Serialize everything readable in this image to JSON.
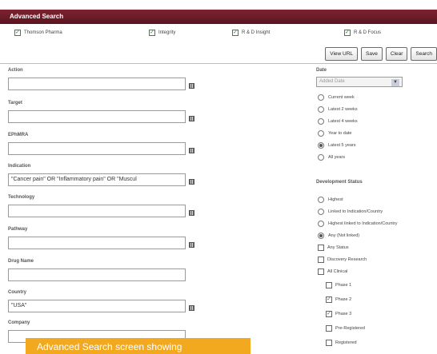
{
  "window": {
    "title": "Advanced Search"
  },
  "databases": [
    {
      "label": "Thomson Pharma",
      "checked": true
    },
    {
      "label": "Integrity",
      "checked": true
    },
    {
      "label": "R & D Insight",
      "checked": true
    },
    {
      "label": "R & D Focus",
      "checked": true
    }
  ],
  "toolbar": {
    "view_url": "View URL",
    "save": "Save",
    "clear": "Clear",
    "search": "Search"
  },
  "fields": [
    {
      "label": "Action",
      "value": ""
    },
    {
      "label": "Target",
      "value": ""
    },
    {
      "label": "EPhMRA",
      "value": ""
    },
    {
      "label": "Indication",
      "value": "\"Cancer pain\" OR \"Inflammatory pain\" OR \"Muscul"
    },
    {
      "label": "Technology",
      "value": ""
    },
    {
      "label": "Pathway",
      "value": ""
    },
    {
      "label": "Drug Name",
      "value": ""
    },
    {
      "label": "Country",
      "value": "\"USA\""
    },
    {
      "label": "Company",
      "value": ""
    }
  ],
  "date": {
    "label": "Date",
    "select_value": "Added Date",
    "options": [
      {
        "label": "Current week",
        "selected": false
      },
      {
        "label": "Latest 2 weeks",
        "selected": false
      },
      {
        "label": "Latest 4 weeks",
        "selected": false
      },
      {
        "label": "Year to date",
        "selected": false
      },
      {
        "label": "Latest 5 years",
        "selected": true
      },
      {
        "label": "All years",
        "selected": false
      }
    ]
  },
  "status": {
    "label": "Development Status",
    "radios": [
      {
        "label": "Highest",
        "selected": false
      },
      {
        "label": "Linked to Indication/Country",
        "selected": false
      },
      {
        "label": "Highest linked to Indication/Country",
        "selected": false
      },
      {
        "label": "Any (Not linked)",
        "selected": true
      }
    ],
    "checks": [
      {
        "label": "Any Status",
        "checked": false
      },
      {
        "label": "Discovery Research",
        "checked": false
      },
      {
        "label": "All Clinical",
        "checked": false
      }
    ],
    "phases": [
      {
        "label": "Phase 1",
        "checked": false
      },
      {
        "label": "Phase 2",
        "checked": true
      },
      {
        "label": "Phase 3",
        "checked": true
      },
      {
        "label": "Pre-Registered",
        "checked": false
      },
      {
        "label": "Registered",
        "checked": false
      }
    ]
  },
  "caption": "Advanced Search screen showing",
  "colors": {
    "title_bar": "#6b1a26",
    "caption_bg": "#f2a91f"
  }
}
